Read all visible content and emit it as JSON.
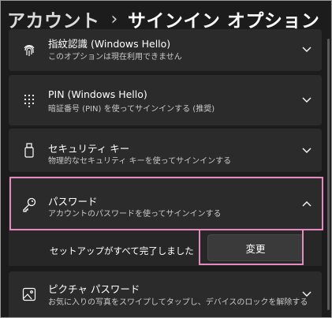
{
  "breadcrumb": {
    "parent": "アカウント",
    "separator": "›",
    "current": "サインイン オプション"
  },
  "options": [
    {
      "title": "指紋認識 (Windows Hello)",
      "desc": "このオプションは現在利用できません",
      "icon": "fingerprint-icon"
    },
    {
      "title": "PIN (Windows Hello)",
      "desc": "暗証番号 (PIN) を使ってサインインする (推奨)",
      "icon": "pin-keypad-icon"
    },
    {
      "title": "セキュリティ キー",
      "desc": "物理的なセキュリティ キーを使ってサインインする",
      "icon": "usb-key-icon"
    },
    {
      "title": "パスワード",
      "desc": "アカウントのパスワードを使ってサインインする",
      "icon": "key-icon"
    },
    {
      "title": "ピクチャ パスワード",
      "desc": "お気に入りの写真をスワイプしてタップし、デバイスのロックを解除する",
      "icon": "picture-icon"
    }
  ],
  "password_detail": {
    "status": "セットアップがすべて完了しました",
    "change_button": "変更"
  },
  "colors": {
    "highlight": "#e28bbf",
    "card": "#2b2b2b",
    "background": "#1c1c1c"
  }
}
